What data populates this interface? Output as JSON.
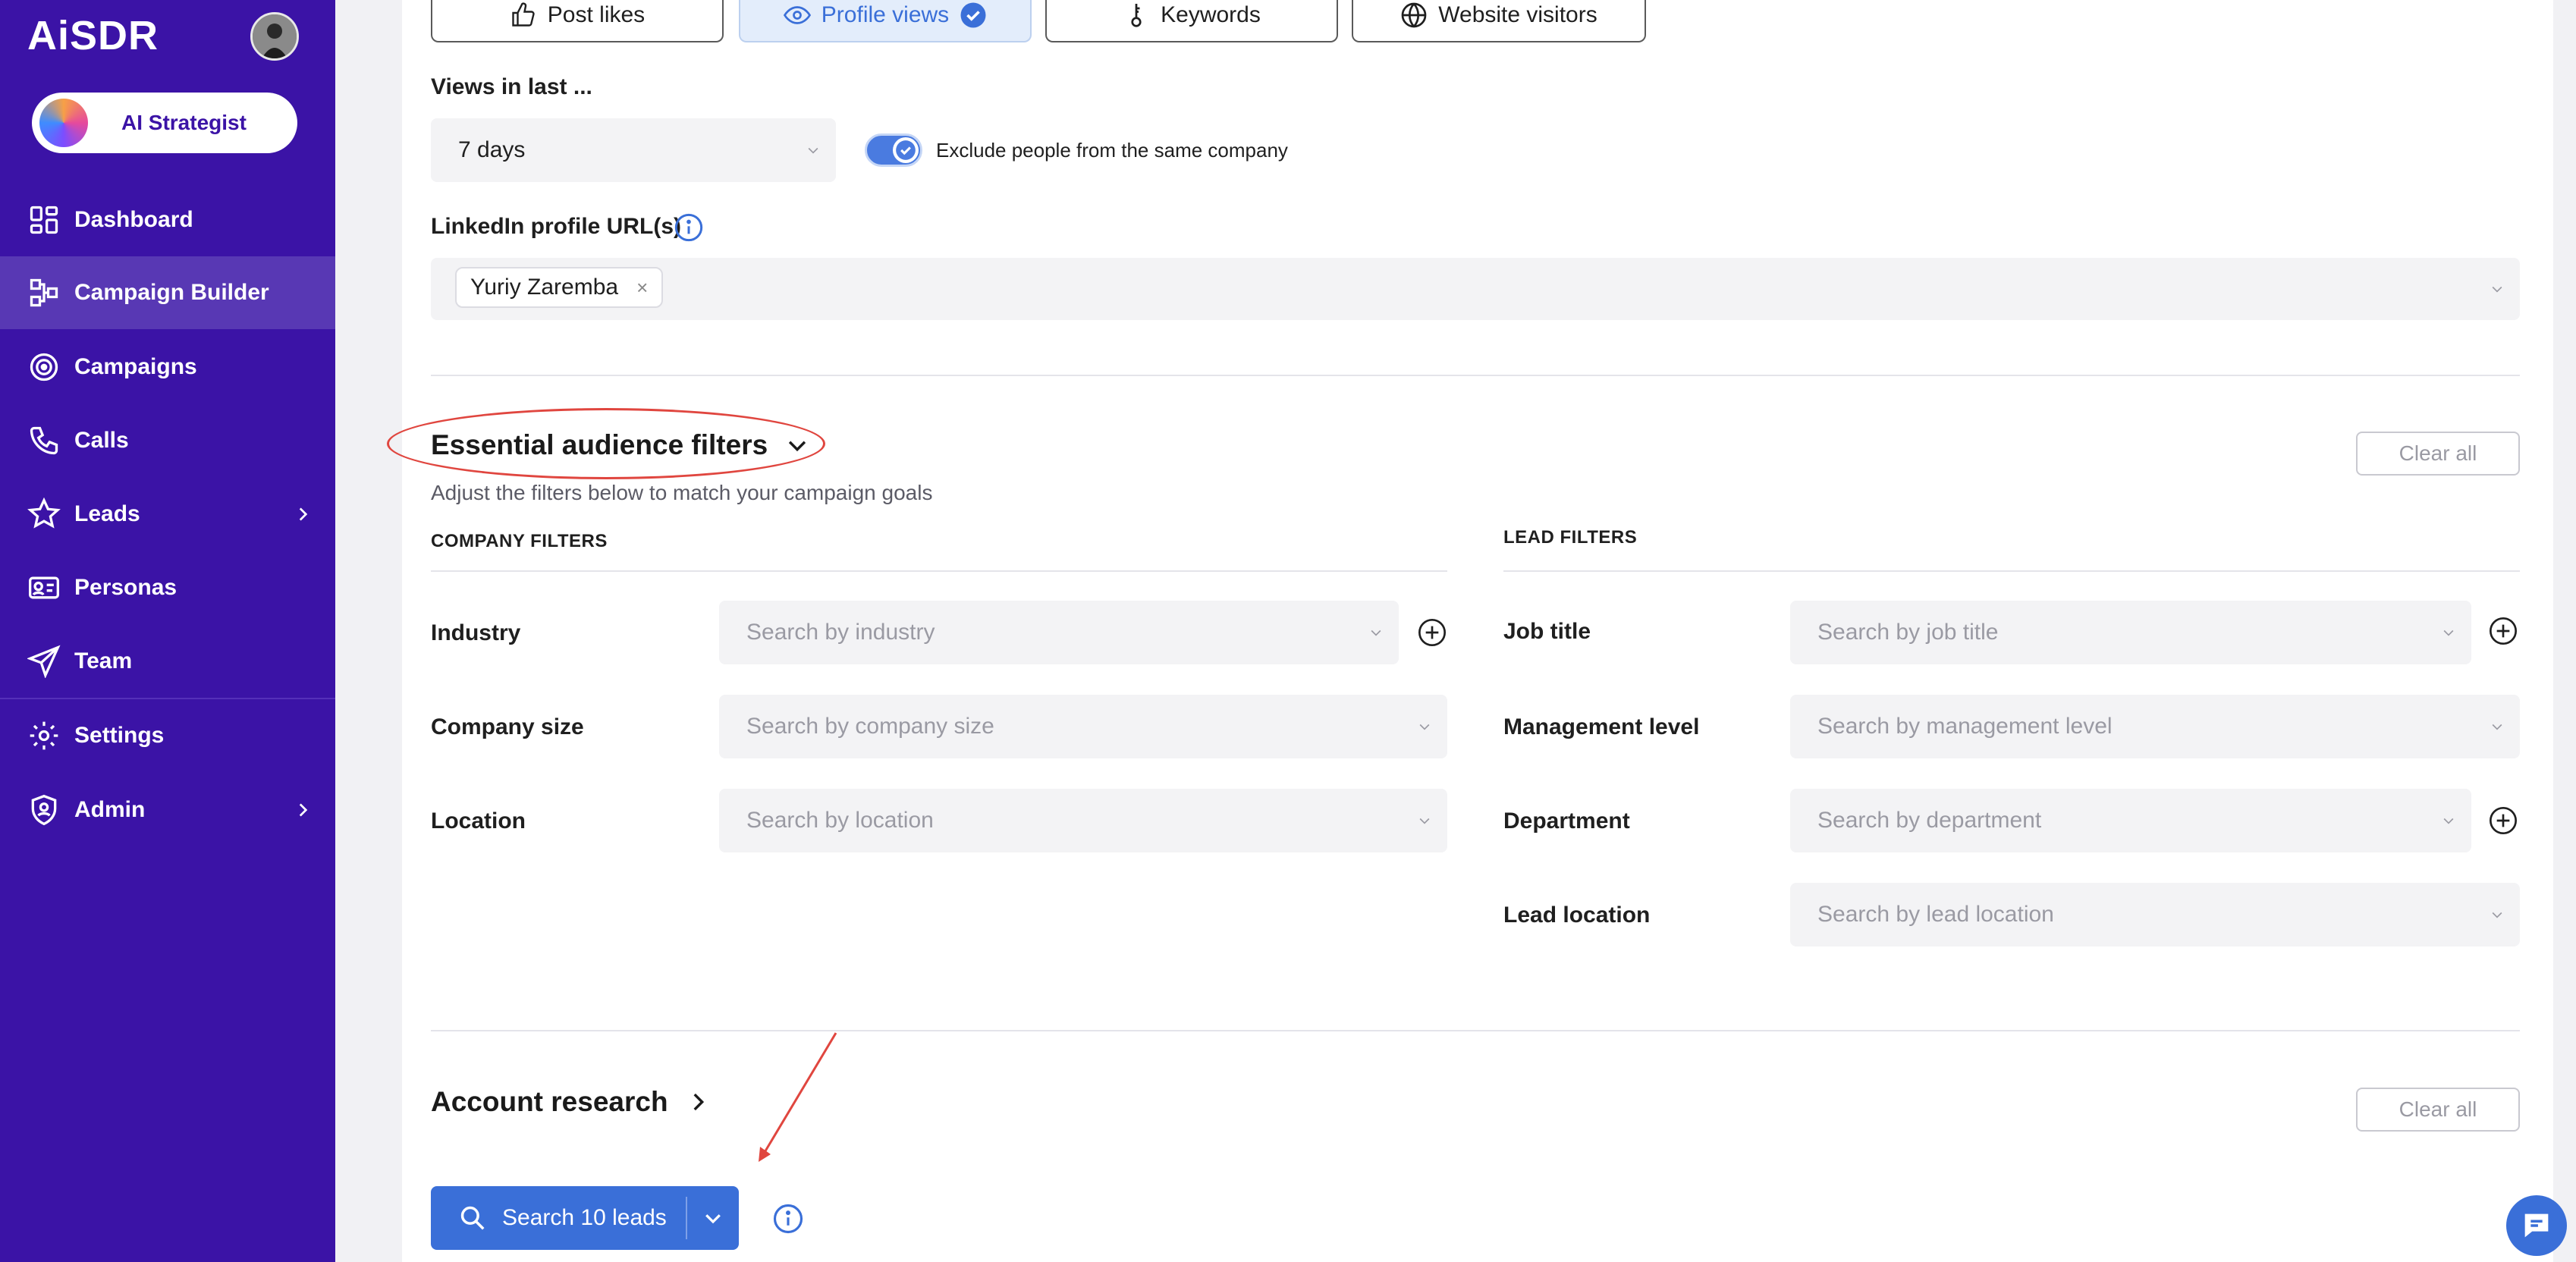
{
  "sidebar": {
    "logo": "AiSDR",
    "strategist_label": "AI Strategist",
    "items": [
      {
        "label": "Dashboard",
        "icon": "dashboard-icon"
      },
      {
        "label": "Campaign Builder",
        "icon": "campaign-builder-icon",
        "active": true
      },
      {
        "label": "Campaigns",
        "icon": "target-icon"
      },
      {
        "label": "Calls",
        "icon": "phone-icon"
      },
      {
        "label": "Leads",
        "icon": "star-person-icon",
        "has_submenu": true
      },
      {
        "label": "Personas",
        "icon": "id-card-icon"
      },
      {
        "label": "Team",
        "icon": "paper-plane-icon"
      },
      {
        "label": "Settings",
        "icon": "gear-icon"
      },
      {
        "label": "Admin",
        "icon": "shield-user-icon",
        "has_submenu": true
      }
    ]
  },
  "tabs": [
    {
      "label": "Post likes",
      "icon": "thumbs-up-icon"
    },
    {
      "label": "Profile views",
      "icon": "eye-icon",
      "selected": true
    },
    {
      "label": "Keywords",
      "icon": "key-icon"
    },
    {
      "label": "Website visitors",
      "icon": "globe-icon"
    }
  ],
  "views": {
    "label": "Views in last ...",
    "value": "7 days",
    "toggle_label": "Exclude people from the same company",
    "toggle_on": true
  },
  "linkedin": {
    "label": "LinkedIn profile URL(s)",
    "chip": "Yuriy Zaremba",
    "chip_remove": "×"
  },
  "essential": {
    "title": "Essential audience filters",
    "subtitle": "Adjust the filters below to match your campaign goals",
    "clear": "Clear all",
    "company_header": "COMPANY FILTERS",
    "lead_header": "LEAD FILTERS",
    "company_filters": [
      {
        "label": "Industry",
        "placeholder": "Search by industry"
      },
      {
        "label": "Company size",
        "placeholder": "Search by company size"
      },
      {
        "label": "Location",
        "placeholder": "Search by location"
      }
    ],
    "lead_filters": [
      {
        "label": "Job title",
        "placeholder": "Search by job title"
      },
      {
        "label": "Management level",
        "placeholder": "Search by management level"
      },
      {
        "label": "Department",
        "placeholder": "Search by department"
      },
      {
        "label": "Lead location",
        "placeholder": "Search by lead location"
      }
    ]
  },
  "account_research": {
    "title": "Account research",
    "clear": "Clear all"
  },
  "search_button": {
    "label": "Search 10 leads"
  },
  "colors": {
    "sidebar": "#3b13a6",
    "accent": "#3a6fd8",
    "annotation": "#e0463f"
  }
}
